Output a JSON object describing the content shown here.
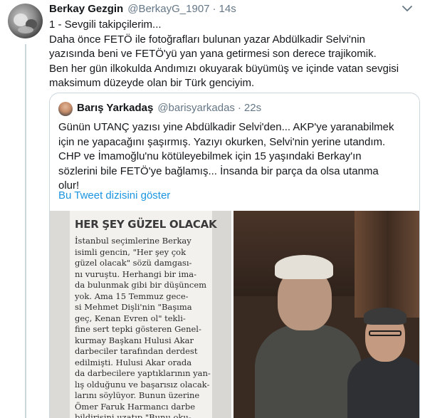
{
  "tweet": {
    "author_name": "Berkay Gezgin",
    "author_handle": "@BerkayG_1907",
    "separator": "·",
    "time": "14s",
    "lines": [
      "1 - Sevgili takipçilerim...",
      "Daha önce FETÖ ile fotoğrafları bulunan yazar Abdülkadir Selvi'nin",
      "yazısında beni ve FETÖ'yü yan yana getirmesi son derece trajikomik.",
      "Ben her gün ilkokulda Andımızı okuyarak büyümüş ve içinde vatan sevgisi",
      "maksimum düzeyde olan bir Türk genciyim."
    ]
  },
  "quoted_tweet": {
    "author_name": "Barış Yarkadaş",
    "author_handle": "@barisyarkadas",
    "separator": "·",
    "time": "22s",
    "lines": [
      "Günün UTANÇ yazısı yine Abdülkadir Selvi'den... AKP'ye yaranabilmek",
      "için ne yapacağını şaşırmış. Yazıyı okurken, Selvi'nin yerine utandım.",
      "CHP ve İmamoğlu'nu kötüleyebilmek için 15 yaşındaki Berkay'ın",
      "sözlerini bile FETÖ'ye bağlamış... İnsanda bir parça da olsa utanma",
      "olur!"
    ],
    "thread_link": "Bu Tweet dizisini göster",
    "newspaper": {
      "headline": "HER ŞEY GÜZEL OLACAK",
      "lines": [
        "İstanbul seçimlerine Berkay",
        "isimli gencin, \"Her şey çok",
        "güzel olacak\" sözü damgası-",
        "nı vuruştu. Herhangi bir ima-",
        "da bulunmak gibi bir düşüncem",
        "yok. Ama 15 Temmuz gece-",
        "si Mehmet Dişli'nin \"Başıma",
        "geç, Kenan Evren ol\" tekli-",
        "fine sert tepki gösteren Genel-",
        "kurmay Başkanı Hulusi Akar",
        "darbeciler tarafından derdest",
        "edilmişti. Hulusi Akar orada",
        "da darbecilere yaptıklarının yan-",
        "lış olduğunu ve başarısız olacak-",
        "larını söylüyor. Bunun üzerine",
        "Ömer Faruk Harmancı darbe",
        "bildirisini uzatıp \"Bunu oku-"
      ]
    }
  },
  "icons": {
    "caret": "chevron-down-icon"
  },
  "colors": {
    "link": "#1b95e0",
    "secondary_text": "#657786",
    "border": "#ccd6dd"
  }
}
